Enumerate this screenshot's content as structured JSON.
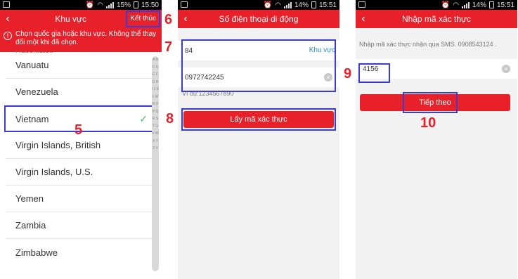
{
  "status": {
    "phone1": {
      "battery_pct": "15%",
      "time": "15:50"
    },
    "phone2": {
      "battery_pct": "14%",
      "time": "15:51"
    },
    "phone3": {
      "battery_pct": "14%",
      "time": "15:51"
    }
  },
  "region_screen": {
    "title": "Khu vực",
    "done_button": "Kết thúc",
    "notice": "Chọn quốc gia hoặc khu vực. Không thể thay đổi một khi đã chọn.",
    "countries": [
      "Vanuatu",
      "Venezuela",
      "Vietnam",
      "Virgin Islands, British",
      "Virgin Islands, U.S.",
      "Yemen",
      "Zambia",
      "Zimbabwe"
    ],
    "selected_country": "Vietnam",
    "partial_top_item": "Uzbekistan",
    "index_letters": "A B C D E F G H I J K L M N O P Q R S T U V W X Y Z #"
  },
  "phone_screen": {
    "title": "Số điện thoại di động",
    "country_code": "84",
    "region_link": "Khu vực",
    "phone_value": "0972742245",
    "example": "Ví dụ:1234567890",
    "get_code_button": "Lấy mã xác thực"
  },
  "verify_screen": {
    "title": "Nhập mã xác thực",
    "instruction": "Nhập mã xác thực nhận qua SMS. 0908543124 .",
    "code_value": "4156",
    "next_button": "Tiếp theo"
  },
  "annotations": {
    "n5": "5",
    "n6": "6",
    "n7": "7",
    "n8": "8",
    "n9": "9",
    "n10": "10"
  },
  "colors": {
    "accent_red": "#e8202a",
    "highlight_blue": "#3b3bd6",
    "link_blue": "#2e8bd8",
    "check_green": "#4cc24c"
  }
}
